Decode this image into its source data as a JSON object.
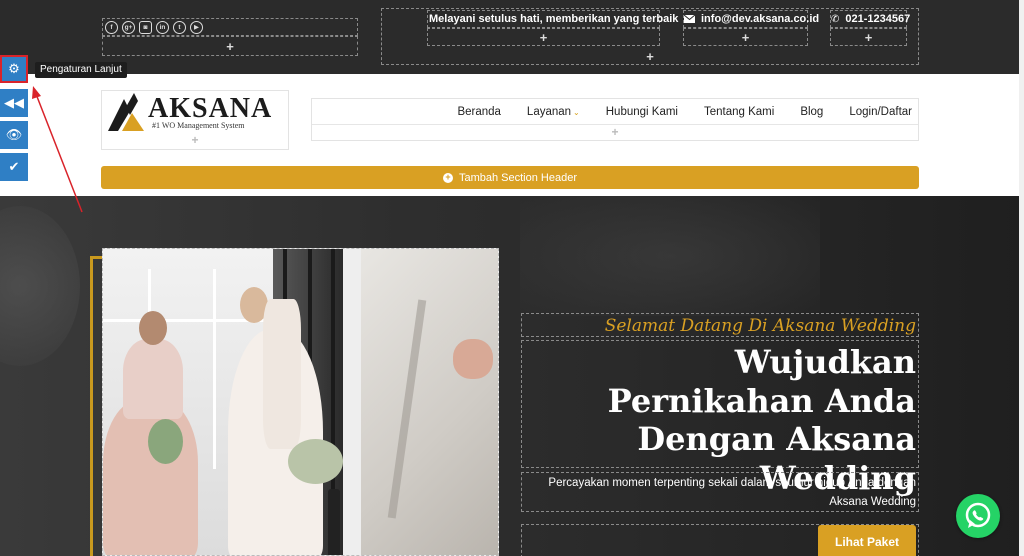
{
  "topbar": {
    "social_icons": [
      "facebook-icon",
      "google-plus-icon",
      "instagram-icon",
      "linkedin-icon",
      "twitter-icon",
      "youtube-icon"
    ],
    "social_glyphs": [
      "f",
      "g+",
      "◙",
      "in",
      "t",
      "▶"
    ],
    "tagline": "Melayani setulus hati, memberikan yang terbaik",
    "email": "info@dev.aksana.co.id",
    "phone": "021-1234567",
    "add_symbol": "+"
  },
  "toolbar": {
    "tooltip": "Pengaturan Lanjut",
    "buttons": [
      "settings-icon",
      "collapse-icon",
      "preview-icon",
      "check-icon"
    ]
  },
  "header": {
    "logo_text": "AKSANA",
    "logo_sub": "#1 WO Management System",
    "nav": [
      "Beranda",
      "Layanan",
      "Hubungi Kami",
      "Tentang Kami",
      "Blog",
      "Login/Daftar"
    ],
    "add_section_label": "Tambah Section Header",
    "add_symbol": "+"
  },
  "hero": {
    "tagline": "Selamat Datang Di Aksana Wedding",
    "headline": "Wujudkan Pernikahan Anda Dengan Aksana Wedding",
    "subtext": "Percayakan momen terpenting sekali dalam seumur hidup Anda dengan Aksana Wedding",
    "button_label": "Lihat Paket"
  },
  "colors": {
    "accent": "#d9a023",
    "toolbar_blue": "#2f7fc5",
    "dark_bar": "#2b2b2b",
    "whatsapp": "#25d366",
    "highlight_red": "#d9232a"
  }
}
